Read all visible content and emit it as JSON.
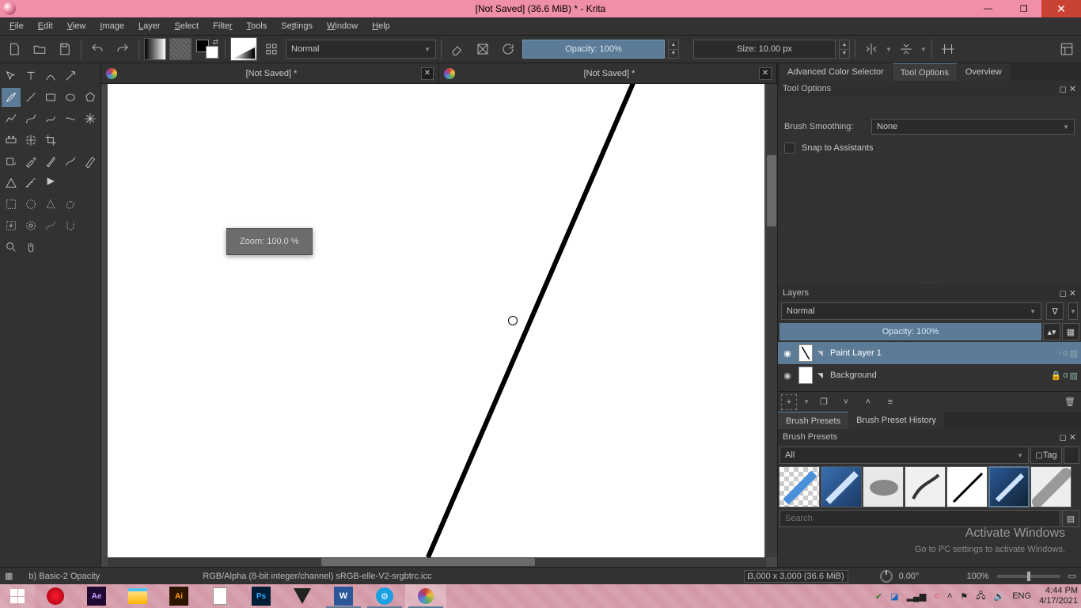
{
  "title": "[Not Saved]  (36.6 MiB)  * - Krita",
  "menu": [
    "File",
    "Edit",
    "View",
    "Image",
    "Layer",
    "Select",
    "Filter",
    "Tools",
    "Settings",
    "Window",
    "Help"
  ],
  "toolbar": {
    "blend_mode": "Normal",
    "opacity_label": "Opacity: 100%",
    "size_label": "Size: 10.00 px"
  },
  "tabs": [
    {
      "label": "[Not Saved]  *"
    },
    {
      "label": "[Not Saved]  *"
    }
  ],
  "zoom_popup": "Zoom: 100.0 %",
  "right": {
    "tabs_top": [
      "Advanced Color Selector",
      "Tool Options",
      "Overview"
    ],
    "tool_options_title": "Tool Options",
    "brush_smoothing_label": "Brush Smoothing:",
    "brush_smoothing_value": "None",
    "snap_label": "Snap to Assistants",
    "layers_title": "Layers",
    "layers_blend": "Normal",
    "layers_opacity": "Opacity:  100%",
    "layers": [
      {
        "name": "Paint Layer 1",
        "selected": true,
        "thumb": "diag"
      },
      {
        "name": "Background",
        "selected": false,
        "thumb": "plain"
      }
    ],
    "bp_tabs": [
      "Brush Presets",
      "Brush Preset History"
    ],
    "bp_title": "Brush Presets",
    "bp_filter": "All",
    "bp_tag": "Tag",
    "bp_search_placeholder": "Search"
  },
  "status": {
    "brush": "b) Basic-2 Opacity",
    "colorspace": "RGB/Alpha (8-bit integer/channel)  sRGB-elle-V2-srgbtrc.icc",
    "dims": "3,000 x 3,000 (36.6 MiB)",
    "angle": "0.00°",
    "zoom": "100%"
  },
  "watermark": {
    "l1": "Activate Windows",
    "l2": "Go to PC settings to activate Windows."
  },
  "tray": {
    "lang": "ENG",
    "time": "4:44 PM",
    "date": "4/17/2021"
  }
}
